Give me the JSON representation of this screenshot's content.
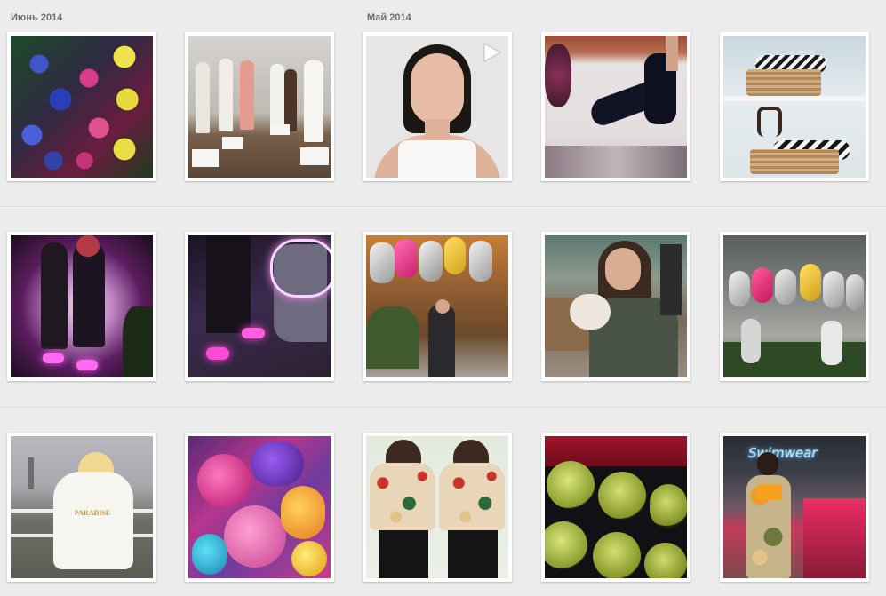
{
  "months": [
    {
      "label": "Июнь 2014"
    },
    {
      "label": "Май 2014"
    }
  ],
  "photos": [
    {
      "name": "flower-garlands",
      "video": false
    },
    {
      "name": "mannequins-store",
      "video": false
    },
    {
      "name": "model-portrait",
      "video": true
    },
    {
      "name": "black-heels",
      "video": false
    },
    {
      "name": "espadrille-wedges",
      "video": false
    },
    {
      "name": "girls-led-shoes",
      "video": false
    },
    {
      "name": "led-sneakers",
      "video": false
    },
    {
      "name": "ashish-balloons-person",
      "video": false
    },
    {
      "name": "woman-with-dog",
      "video": false
    },
    {
      "name": "ashish-balloons-crowd",
      "video": false
    },
    {
      "name": "paradise-sweatshirt",
      "video": false
    },
    {
      "name": "parrot-balloons",
      "video": false
    },
    {
      "name": "twins-floral-shirts",
      "video": false
    },
    {
      "name": "green-eyeshadows",
      "video": false
    },
    {
      "name": "swimwear-store",
      "video": false
    }
  ],
  "sweatshirt_print": "PARADISE",
  "store_sign": "Swimwear"
}
